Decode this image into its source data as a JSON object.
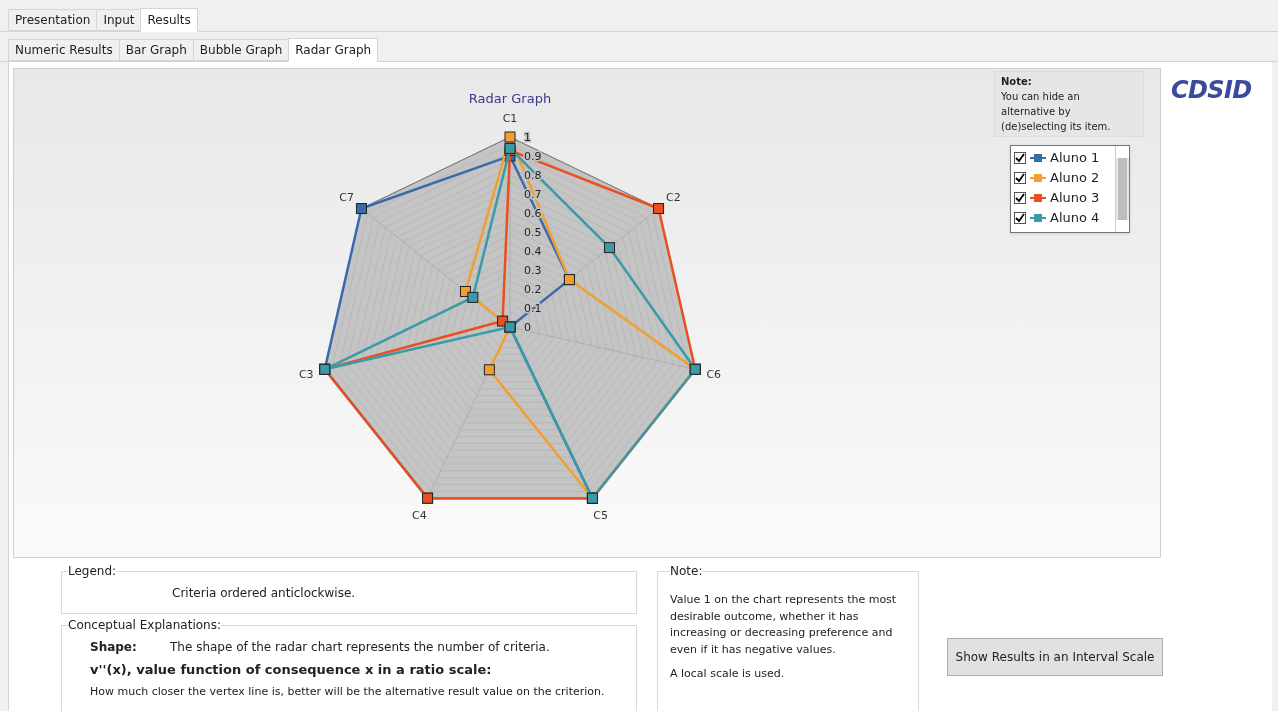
{
  "main_tabs": [
    {
      "label": "Presentation",
      "selected": false
    },
    {
      "label": "Input",
      "selected": false
    },
    {
      "label": "Results",
      "selected": true
    }
  ],
  "sub_tabs": [
    {
      "label": "Numeric Results",
      "selected": false
    },
    {
      "label": "Bar Graph",
      "selected": false
    },
    {
      "label": "Bubble Graph",
      "selected": false
    },
    {
      "label": "Radar Graph",
      "selected": true
    }
  ],
  "chart": {
    "title": "Radar Graph",
    "axis_labels": [
      "C1",
      "C2",
      "C6",
      "C5",
      "C4",
      "C3",
      "C7"
    ],
    "tick_labels": [
      "1",
      "0.9",
      "0.8",
      "0.7",
      "0.6",
      "0.5",
      "0.4",
      "0.3",
      "0.2",
      "0.1",
      "0"
    ]
  },
  "note_box": {
    "title": "Note:",
    "text": "You can hide an alternative by (de)selecting its item."
  },
  "alternatives": [
    {
      "label": "Aluno 1",
      "checked": true,
      "color": "#3a6aa8"
    },
    {
      "label": "Aluno 2",
      "checked": true,
      "color": "#f0a030"
    },
    {
      "label": "Aluno 3",
      "checked": true,
      "color": "#e85020"
    },
    {
      "label": "Aluno 4",
      "checked": true,
      "color": "#3a9aa8"
    }
  ],
  "logo": "CDSID",
  "legend": {
    "title": "Legend:",
    "text": "Criteria ordered anticlockwise."
  },
  "conceptual": {
    "title": "Conceptual Explanations:",
    "shape_label": "Shape:",
    "shape_text": "The shape of the radar chart represents the number of criteria.",
    "heading": "v''(x), value function of consequence x in a ratio scale:",
    "text": "How much closer the vertex line is, better will be the alternative result value on the criterion."
  },
  "note": {
    "title": "Note:",
    "paragraphs": [
      "Value 1 on the chart represents the most desirable outcome, whether it has increasing or decreasing preference and even if it has negative values.",
      "A local scale is used."
    ]
  },
  "interval_button": "Show Results in an Interval Scale"
}
